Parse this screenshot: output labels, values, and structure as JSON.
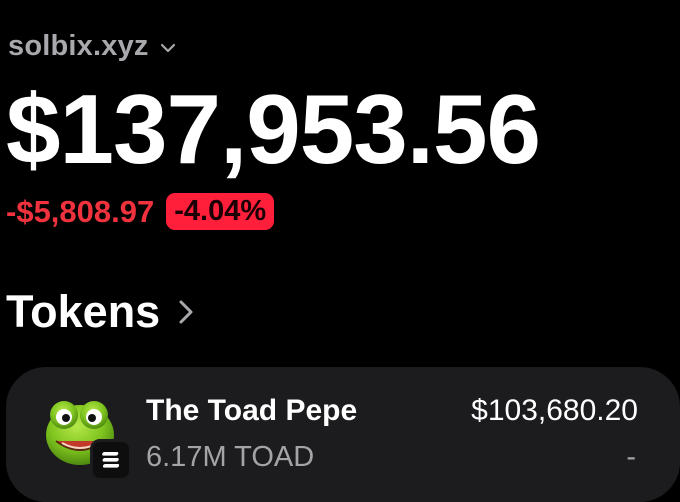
{
  "colors": {
    "background": "#000000",
    "negative": "#f0323e",
    "negative_badge": "#ff1f3a",
    "card": "#1c1c1e",
    "muted_text": "#a4a4a8"
  },
  "account": {
    "name": "solbix.xyz",
    "dropdown_icon": "chevron-down-icon"
  },
  "portfolio": {
    "balance": "$137,953.56",
    "change_amount": "-$5,808.97",
    "change_percent": "-4.04%"
  },
  "tokens_section": {
    "title": "Tokens",
    "nav_icon": "chevron-right-icon"
  },
  "tokens": [
    {
      "name": "The Toad Pepe",
      "amount": "6.17M TOAD",
      "value": "$103,680.20",
      "change": "-",
      "avatar_icon": "toad-avatar-icon",
      "chain_icon": "solana-icon"
    }
  ]
}
